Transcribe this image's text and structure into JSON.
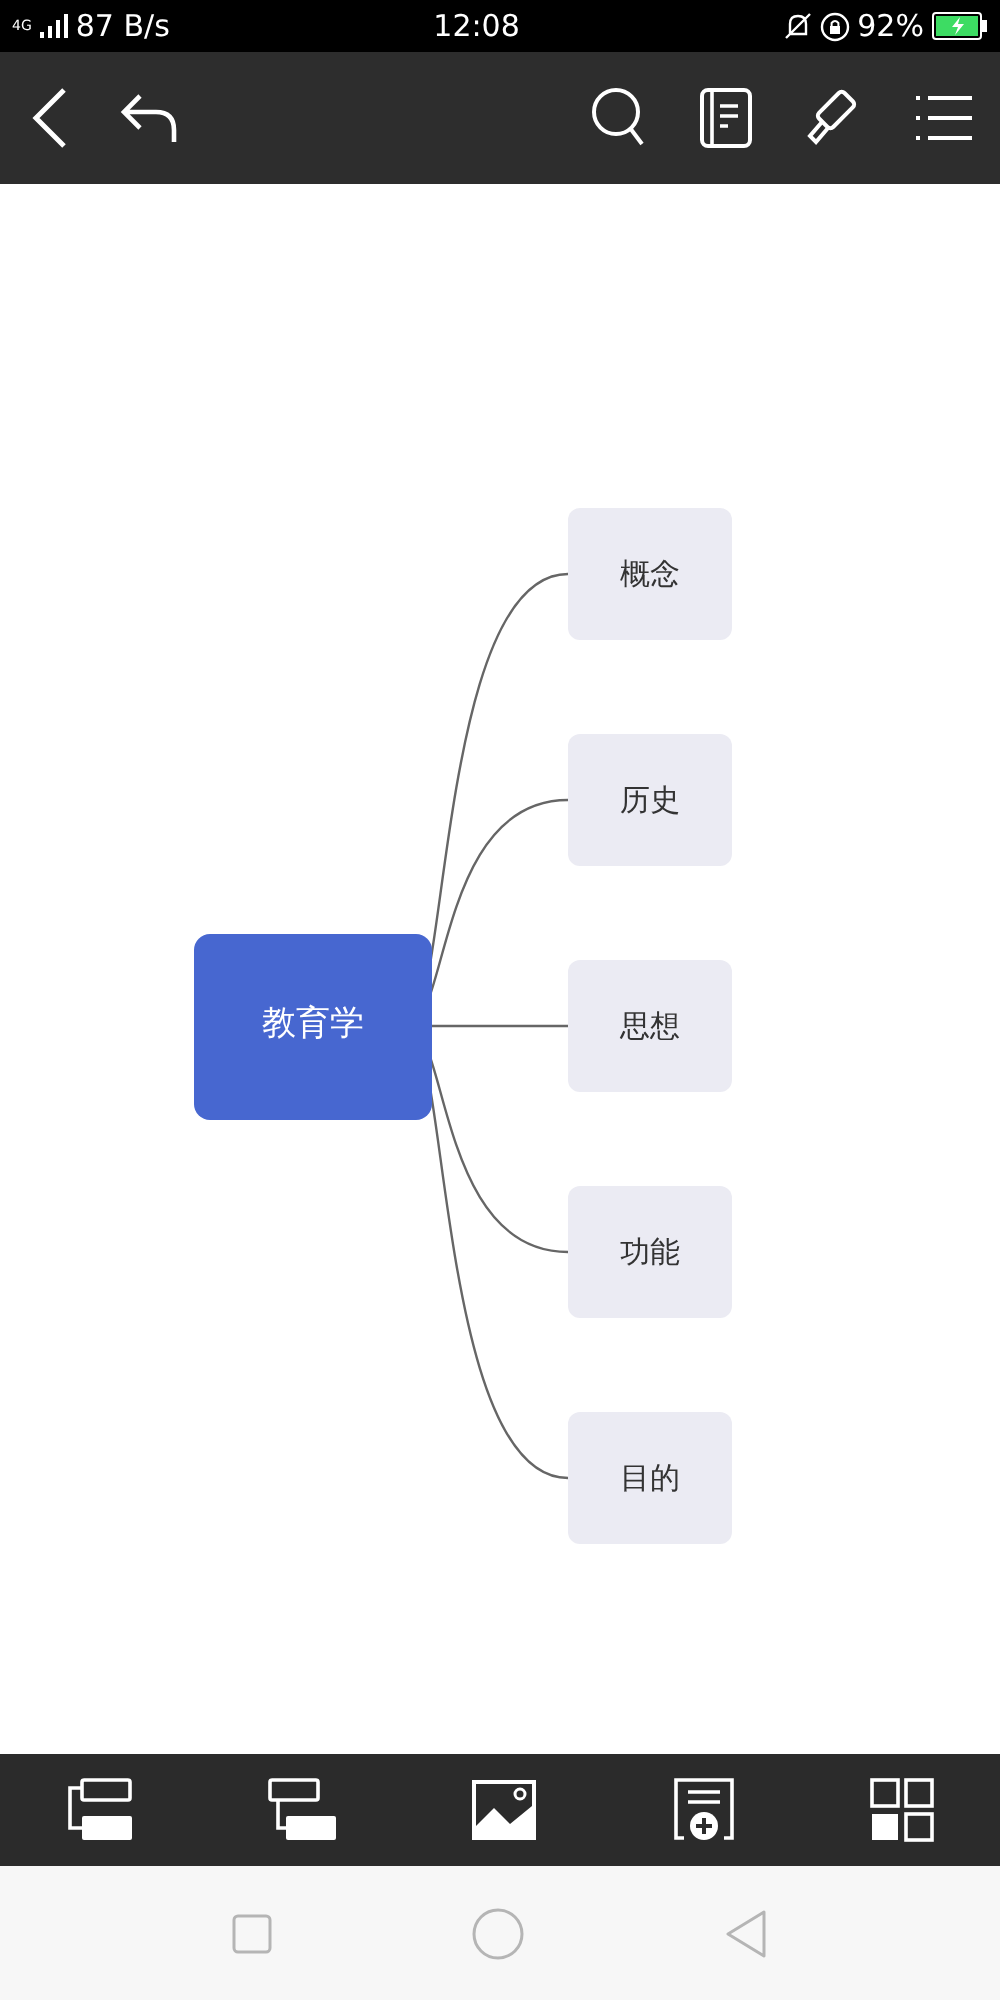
{
  "status_bar": {
    "network": "4G",
    "speed": "87 B/s",
    "time": "12:08",
    "battery": "92%"
  },
  "mind_map": {
    "root": {
      "label": "教育学",
      "children": [
        {
          "label": "概念"
        },
        {
          "label": "历史"
        },
        {
          "label": "思想"
        },
        {
          "label": "功能"
        },
        {
          "label": "目的"
        }
      ]
    }
  }
}
